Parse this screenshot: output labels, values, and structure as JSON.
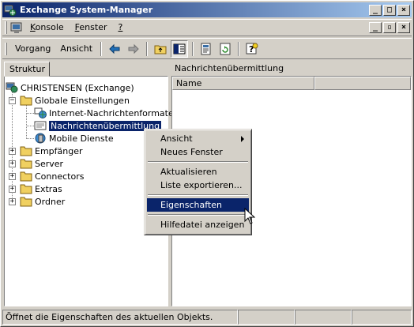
{
  "window": {
    "title": "Exchange System-Manager",
    "title_buttons": [
      "_",
      "□",
      "×"
    ]
  },
  "menubar": {
    "items": [
      {
        "label": "Konsole",
        "key": "K",
        "rest": "onsole"
      },
      {
        "label": "Fenster",
        "key": "F",
        "rest": "enster"
      },
      {
        "label": "?",
        "key": "?",
        "rest": ""
      }
    ],
    "mdi_buttons": [
      "_",
      "▫",
      "×"
    ]
  },
  "toolbar": {
    "vorgang": "Vorgang",
    "ansicht": "Ansicht",
    "icons": [
      "back-arrow-icon",
      "forward-arrow-icon",
      "up-folder-icon",
      "show-hide-tree-icon",
      "properties-icon",
      "refresh-icon",
      "help-icon"
    ]
  },
  "left": {
    "tab_label": "Struktur",
    "tree": [
      {
        "label": "CHRISTENSEN (Exchange)",
        "icon": "server-org-icon"
      },
      {
        "label": "Globale Einstellungen",
        "icon": "folder-icon",
        "expander": "−"
      },
      {
        "label": "Internet-Nachrichtenformate",
        "icon": "globe-icon"
      },
      {
        "label": "Nachrichtenübermittlung",
        "icon": "message-delivery-icon",
        "selected": true
      },
      {
        "label": "Mobile Dienste",
        "icon": "mobile-services-icon"
      },
      {
        "label": "Empfänger",
        "icon": "folder-icon",
        "expander": "+"
      },
      {
        "label": "Server",
        "icon": "folder-icon",
        "expander": "+"
      },
      {
        "label": "Connectors",
        "icon": "folder-icon",
        "expander": "+"
      },
      {
        "label": "Extras",
        "icon": "folder-icon",
        "expander": "+"
      },
      {
        "label": "Ordner",
        "icon": "folder-icon",
        "expander": "+"
      }
    ]
  },
  "right": {
    "title": "Nachrichtenübermittlung",
    "columns": [
      "Name",
      ""
    ]
  },
  "context_menu": {
    "items": [
      {
        "label": "Ansicht",
        "submenu": true
      },
      {
        "label": "Neues Fenster"
      },
      {
        "sep": true
      },
      {
        "label": "Aktualisieren"
      },
      {
        "label": "Liste exportieren..."
      },
      {
        "sep": true
      },
      {
        "label": "Eigenschaften",
        "highlighted": true
      },
      {
        "sep": true
      },
      {
        "label": "Hilfedatei anzeigen"
      }
    ]
  },
  "statusbar": {
    "text": "Öffnet die Eigenschaften des aktuellen Objekts."
  },
  "colors": {
    "title_start": "#0a246a",
    "title_end": "#a6caf0",
    "face": "#d4d0c8",
    "highlight": "#0a246a"
  }
}
